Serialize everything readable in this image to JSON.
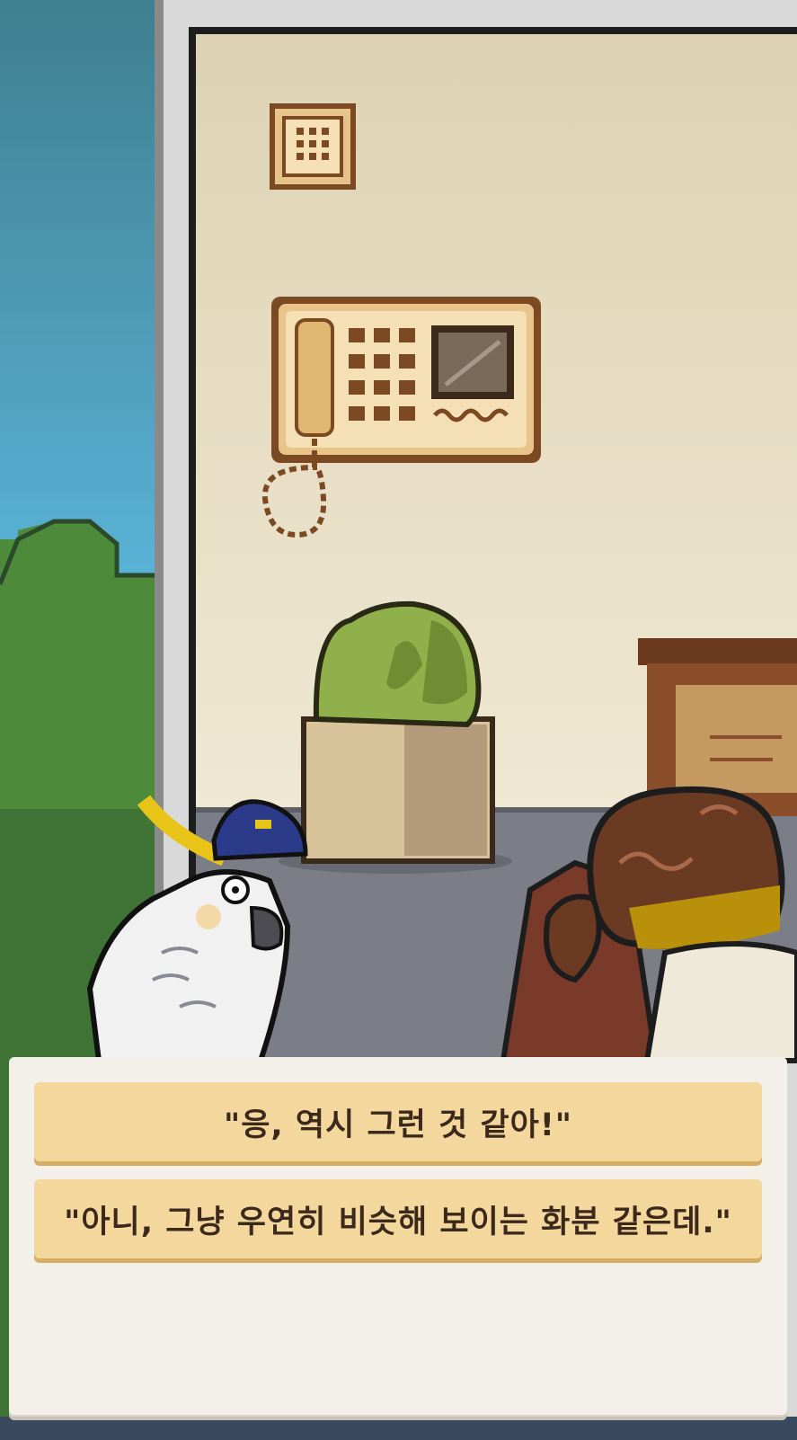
{
  "scene": {
    "name": "office-room",
    "icons": [
      "intercom-panel-icon",
      "wall-phone-icon",
      "potted-plant-icon",
      "cockatoo-character",
      "brown-bird-character",
      "desk"
    ]
  },
  "dialog": {
    "choices": [
      {
        "label": "\"응, 역시 그런 것 같아!\""
      },
      {
        "label": "\"아니, 그냥 우연히 비슷해 보이는 화분 같은데.\""
      }
    ]
  },
  "colors": {
    "sky": "#5ab0d6",
    "wall": "#ebe3cc",
    "floor": "#7a7c86",
    "choice_bg": "#f3d79d",
    "panel_bg": "#f3f0ea"
  }
}
